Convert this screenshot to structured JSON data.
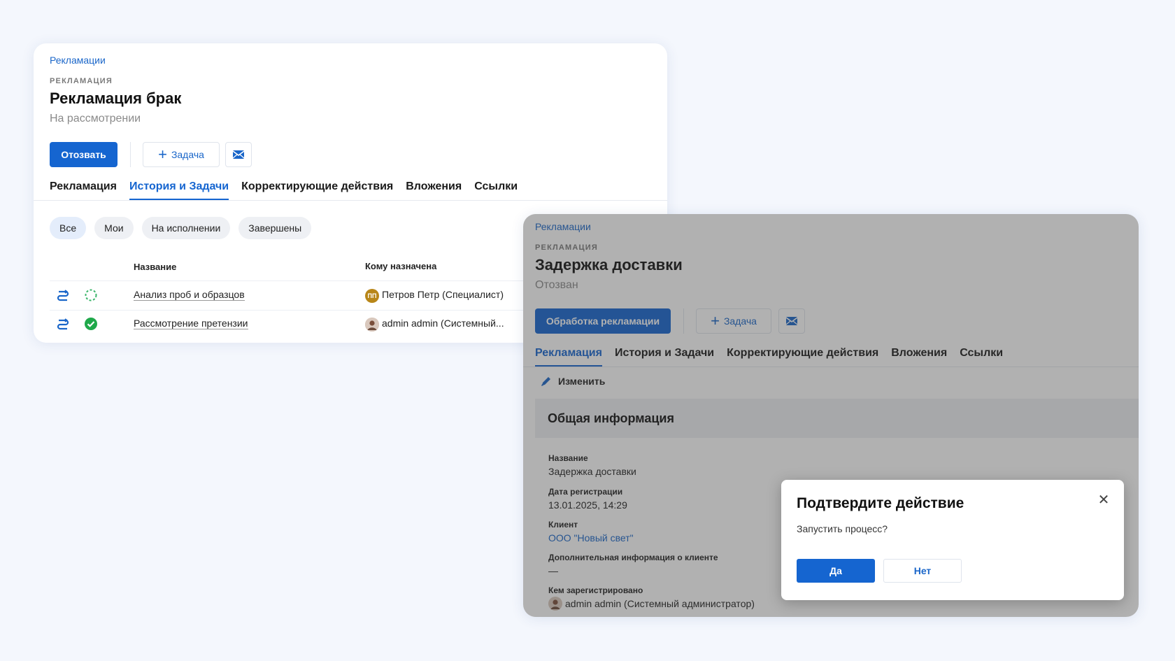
{
  "card1": {
    "breadcrumb": "Рекламации",
    "kicker": "РЕКЛАМАЦИЯ",
    "title": "Рекламация брак",
    "status": "На рассмотрении",
    "primary_button": "Отозвать",
    "task_button": "Задача",
    "tabs": [
      "Рекламация",
      "История и Задачи",
      "Корректирующие действия",
      "Вложения",
      "Ссылки"
    ],
    "active_tab": "История и Задачи",
    "chips": [
      "Все",
      "Мои",
      "На исполнении",
      "Завершены"
    ],
    "table": {
      "headers": [
        "Название",
        "Кому назначена"
      ],
      "rows": [
        {
          "name": "Анализ проб и образцов",
          "assignee": "Петров Петр (Специалист)",
          "avatar_initials": "ПП",
          "state": "in-progress"
        },
        {
          "name": "Рассмотрение претензии",
          "assignee": "admin admin (Системный...",
          "avatar_initials": "",
          "state": "done"
        }
      ]
    }
  },
  "card2": {
    "breadcrumb": "Рекламации",
    "kicker": "РЕКЛАМАЦИЯ",
    "title": "Задержка доставки",
    "status": "Отозван",
    "primary_button": "Обработка рекламации",
    "task_button": "Задача",
    "tabs": [
      "Рекламация",
      "История и Задачи",
      "Корректирующие действия",
      "Вложения",
      "Ссылки"
    ],
    "active_tab": "Рекламация",
    "edit_label": "Изменить",
    "section_title": "Общая информация",
    "fields": [
      {
        "label": "Название",
        "value": "Задержка доставки"
      },
      {
        "label": "Дата регистрации",
        "value": "13.01.2025, 14:29"
      },
      {
        "label": "Клиент",
        "value": "ООО \"Новый свет\""
      },
      {
        "label": "Дополнительная информация о клиенте",
        "value": "—"
      },
      {
        "label": "Кем зарегистрировано",
        "value": "admin admin (Системный администратор)"
      }
    ]
  },
  "dialog": {
    "title": "Подтвердите действие",
    "text": "Запустить процесс?",
    "yes": "Да",
    "no": "Нет"
  },
  "colors": {
    "accent": "#1565d0",
    "link": "#1a66c9",
    "success": "#1fa84a",
    "background": "#f4f7fd"
  },
  "icons": [
    "plus-icon",
    "mail-icon",
    "workflow-icon",
    "progress-icon",
    "check-icon",
    "pencil-icon",
    "close-icon"
  ]
}
